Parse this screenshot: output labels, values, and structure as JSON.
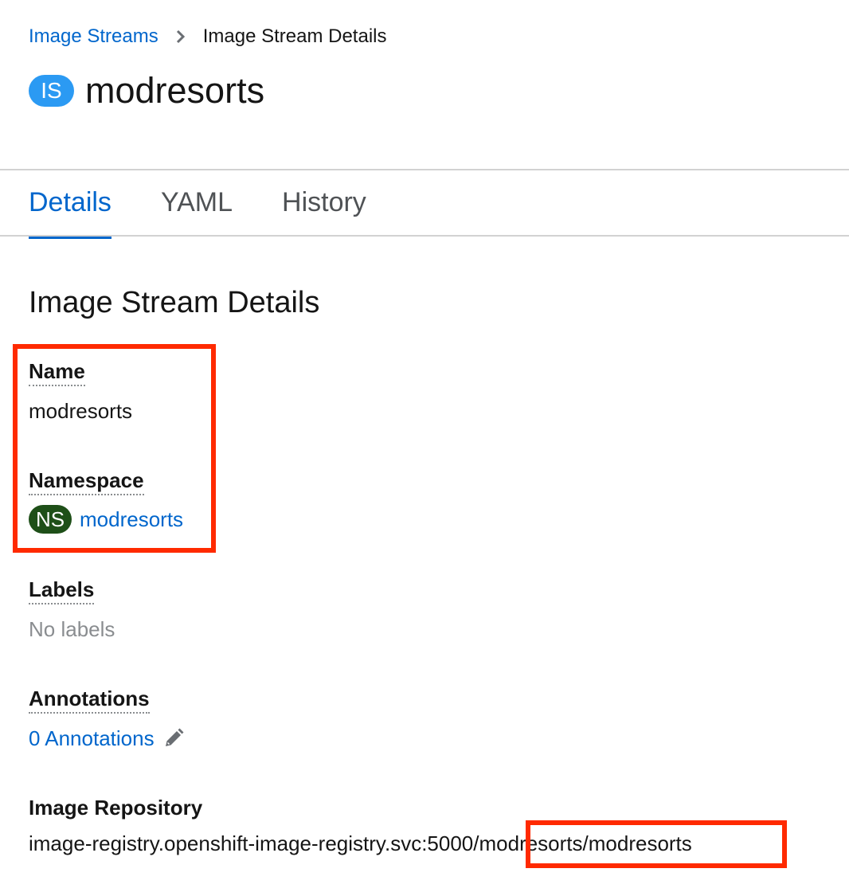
{
  "breadcrumb": {
    "parent": "Image Streams",
    "current": "Image Stream Details"
  },
  "header": {
    "badge": "IS",
    "title": "modresorts"
  },
  "tabs": [
    {
      "label": "Details",
      "active": true
    },
    {
      "label": "YAML",
      "active": false
    },
    {
      "label": "History",
      "active": false
    }
  ],
  "section": {
    "title": "Image Stream Details"
  },
  "details": {
    "name_label": "Name",
    "name_value": "modresorts",
    "namespace_label": "Namespace",
    "namespace_badge": "NS",
    "namespace_value": "modresorts",
    "labels_label": "Labels",
    "labels_value": "No labels",
    "annotations_label": "Annotations",
    "annotations_value": "0 Annotations",
    "repo_label": "Image Repository",
    "repo_prefix": "image-registry.openshift-image-registry.svc:5000/",
    "repo_suffix": "modresorts/modresorts"
  },
  "colors": {
    "link": "#0066cc",
    "is_badge": "#2b9af3",
    "ns_badge": "#1e4f18",
    "highlight": "#ff2a00"
  },
  "icons": {
    "breadcrumb_separator": "chevron-right-icon",
    "edit": "pencil-icon"
  }
}
